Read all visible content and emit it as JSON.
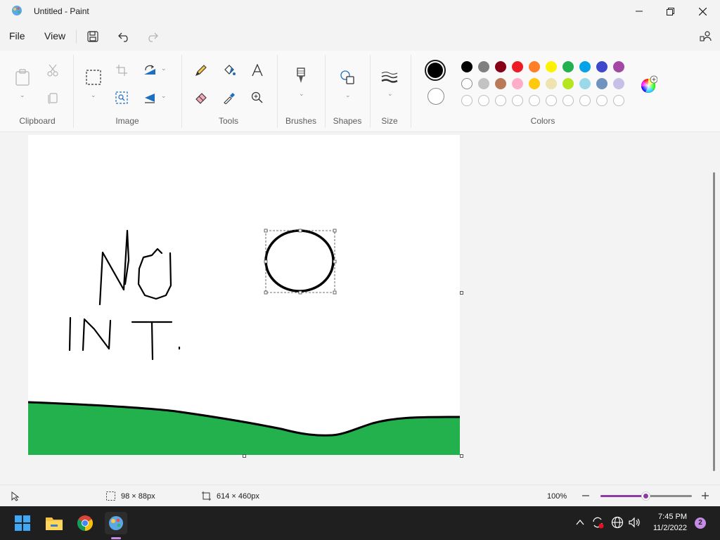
{
  "window": {
    "title": "Untitled - Paint",
    "icons": [
      "paint-app-icon",
      "minimize-icon",
      "maximize-icon",
      "close-icon"
    ]
  },
  "menu": {
    "file": "File",
    "view": "View",
    "icons": [
      "save-icon",
      "undo-icon",
      "redo-icon",
      "profile-icon"
    ]
  },
  "ribbon": {
    "clipboard": {
      "label": "Clipboard",
      "icons": [
        "paste-icon",
        "cut-icon",
        "copy-icon"
      ]
    },
    "image": {
      "label": "Image",
      "icons": [
        "select-icon",
        "crop-icon",
        "resize-icon",
        "rotate-icon",
        "image-search-icon"
      ]
    },
    "tools": {
      "label": "Tools",
      "icons": [
        "pencil-icon",
        "fill-icon",
        "text-icon",
        "eraser-icon",
        "color-picker-icon",
        "magnifier-icon"
      ]
    },
    "brushes": {
      "label": "Brushes",
      "icons": [
        "brush-icon"
      ]
    },
    "shapes": {
      "label": "Shapes",
      "icons": [
        "shapes-icon"
      ]
    },
    "size": {
      "label": "Size",
      "icons": [
        "size-icon"
      ]
    },
    "colors": {
      "label": "Colors",
      "primary": "#000000",
      "secondary": "#ffffff",
      "row1": [
        "#000000",
        "#7f7f7f",
        "#880015",
        "#ed1c24",
        "#ff7f27",
        "#fff200",
        "#22b14c",
        "#00a2e8",
        "#3f48cc",
        "#a349a4"
      ],
      "row2": [
        "#ffffff",
        "#c3c3c3",
        "#b97a57",
        "#ffaec9",
        "#ffc90e",
        "#efe4b0",
        "#b5e61d",
        "#99d9ea",
        "#7092be",
        "#c8bfe7"
      ],
      "row3_empty_count": 10,
      "edit_colors_icon": "color-wheel-icon"
    }
  },
  "canvas": {
    "background": "#ffffff",
    "ground_color": "#22b14c",
    "stroke_color": "#000000"
  },
  "status": {
    "selection_size": "98 × 88px",
    "canvas_size": "614 × 460px",
    "zoom": "100%",
    "zoom_level": 0.5,
    "icons": [
      "pointer-icon",
      "selection-icon",
      "canvas-size-icon",
      "zoom-out-icon",
      "zoom-in-icon"
    ]
  },
  "taskbar": {
    "time": "7:45 PM",
    "date": "11/2/2022",
    "notification_count": "2",
    "icons": [
      "windows-start-icon",
      "file-explorer-icon",
      "chrome-icon",
      "paint-taskbar-icon",
      "chevron-up-icon",
      "sync-icon",
      "network-icon",
      "volume-icon"
    ]
  }
}
